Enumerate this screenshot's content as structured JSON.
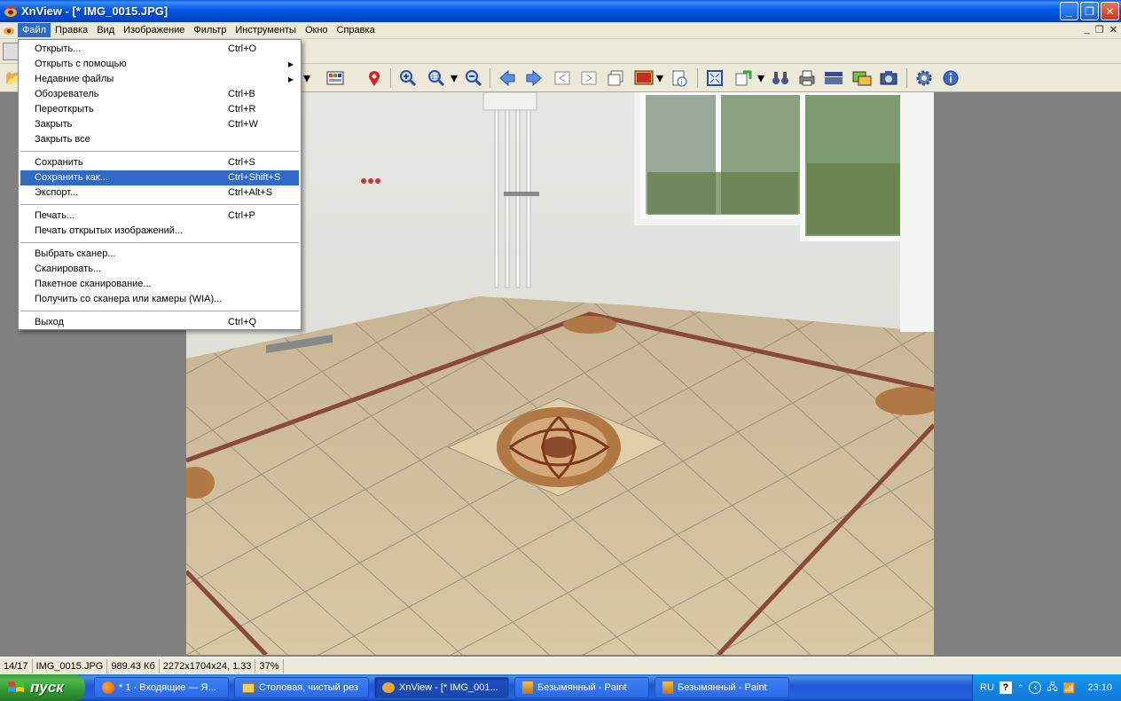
{
  "window": {
    "title": "XnView - [* IMG_0015.JPG]"
  },
  "menubar": {
    "items": [
      "Файл",
      "Правка",
      "Вид",
      "Изображение",
      "Фильтр",
      "Инструменты",
      "Окно",
      "Справка"
    ]
  },
  "file_menu": {
    "open": {
      "label": "Открыть...",
      "shortcut": "Ctrl+O"
    },
    "open_with": {
      "label": "Открыть с помощью"
    },
    "recent": {
      "label": "Недавние файлы"
    },
    "browser": {
      "label": "Обозреватель",
      "shortcut": "Ctrl+B"
    },
    "reopen": {
      "label": "Переоткрыть",
      "shortcut": "Ctrl+R"
    },
    "close": {
      "label": "Закрыть",
      "shortcut": "Ctrl+W"
    },
    "close_all": {
      "label": "Закрыть все"
    },
    "save": {
      "label": "Сохранить",
      "shortcut": "Ctrl+S"
    },
    "save_as": {
      "label": "Сохранить как...",
      "shortcut": "Ctrl+Shift+S"
    },
    "export": {
      "label": "Экспорт...",
      "shortcut": "Ctrl+Alt+S"
    },
    "print": {
      "label": "Печать...",
      "shortcut": "Ctrl+P"
    },
    "print_open": {
      "label": "Печать открытых изображений..."
    },
    "select_scanner": {
      "label": "Выбрать сканер..."
    },
    "scan": {
      "label": "Сканировать..."
    },
    "batch_scan": {
      "label": "Пакетное сканирование..."
    },
    "wia": {
      "label": "Получить со сканера или камеры (WIA)..."
    },
    "exit": {
      "label": "Выход",
      "shortcut": "Ctrl+Q"
    }
  },
  "statusbar": {
    "index": "14/17",
    "filename": "IMG_0015.JPG",
    "size": "989.43 Кб",
    "dimensions": "2272x1704x24, 1.33",
    "zoom": "37%"
  },
  "taskbar": {
    "start": "пуск",
    "tasks": [
      "* 1 · Входящие — Я...",
      "Столовая, чистый рез",
      "XnView - [* IMG_001...",
      "Безымянный - Paint",
      "Безымянный - Paint"
    ],
    "lang": "RU",
    "clock": "23:10"
  },
  "colors": {
    "selection": "#316ac5",
    "titlebar": "#0058e6",
    "taskbar": "#2157d7"
  }
}
